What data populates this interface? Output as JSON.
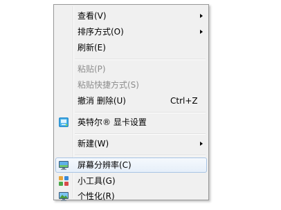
{
  "context_menu": {
    "items": [
      {
        "label": "查看(V)",
        "has_submenu": true
      },
      {
        "label": "排序方式(O)",
        "has_submenu": true
      },
      {
        "label": "刷新(E)"
      },
      {
        "label": "粘贴(P)",
        "disabled": true
      },
      {
        "label": "粘贴快捷方式(S)",
        "disabled": true
      },
      {
        "label": "撤消 删除(U)",
        "shortcut": "Ctrl+Z"
      },
      {
        "label": "英特尔® 显卡设置",
        "icon": "intel-graphics-icon"
      },
      {
        "label": "新建(W)",
        "has_submenu": true
      },
      {
        "label": "屏幕分辨率(C)",
        "icon": "display-resolution-icon",
        "highlighted": true
      },
      {
        "label": "小工具(G)",
        "icon": "gadgets-icon"
      },
      {
        "label": "个性化(R)",
        "icon": "personalize-icon"
      }
    ]
  },
  "colors": {
    "menu_background": "#f0f0f0",
    "menu_border": "#979797",
    "highlight_border": "#a8c4e4",
    "disabled_text": "#8d8d8d"
  }
}
